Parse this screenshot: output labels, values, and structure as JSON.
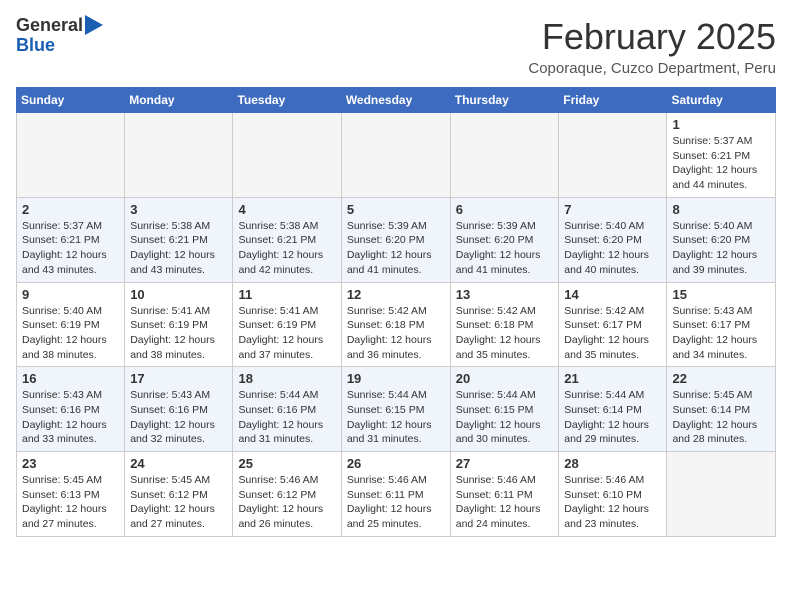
{
  "header": {
    "logo_line1": "General",
    "logo_line2": "Blue",
    "month": "February 2025",
    "location": "Coporaque, Cuzco Department, Peru"
  },
  "days_of_week": [
    "Sunday",
    "Monday",
    "Tuesday",
    "Wednesday",
    "Thursday",
    "Friday",
    "Saturday"
  ],
  "weeks": [
    [
      {
        "day": "",
        "info": ""
      },
      {
        "day": "",
        "info": ""
      },
      {
        "day": "",
        "info": ""
      },
      {
        "day": "",
        "info": ""
      },
      {
        "day": "",
        "info": ""
      },
      {
        "day": "",
        "info": ""
      },
      {
        "day": "1",
        "info": "Sunrise: 5:37 AM\nSunset: 6:21 PM\nDaylight: 12 hours and 44 minutes."
      }
    ],
    [
      {
        "day": "2",
        "info": "Sunrise: 5:37 AM\nSunset: 6:21 PM\nDaylight: 12 hours and 43 minutes."
      },
      {
        "day": "3",
        "info": "Sunrise: 5:38 AM\nSunset: 6:21 PM\nDaylight: 12 hours and 43 minutes."
      },
      {
        "day": "4",
        "info": "Sunrise: 5:38 AM\nSunset: 6:21 PM\nDaylight: 12 hours and 42 minutes."
      },
      {
        "day": "5",
        "info": "Sunrise: 5:39 AM\nSunset: 6:20 PM\nDaylight: 12 hours and 41 minutes."
      },
      {
        "day": "6",
        "info": "Sunrise: 5:39 AM\nSunset: 6:20 PM\nDaylight: 12 hours and 41 minutes."
      },
      {
        "day": "7",
        "info": "Sunrise: 5:40 AM\nSunset: 6:20 PM\nDaylight: 12 hours and 40 minutes."
      },
      {
        "day": "8",
        "info": "Sunrise: 5:40 AM\nSunset: 6:20 PM\nDaylight: 12 hours and 39 minutes."
      }
    ],
    [
      {
        "day": "9",
        "info": "Sunrise: 5:40 AM\nSunset: 6:19 PM\nDaylight: 12 hours and 38 minutes."
      },
      {
        "day": "10",
        "info": "Sunrise: 5:41 AM\nSunset: 6:19 PM\nDaylight: 12 hours and 38 minutes."
      },
      {
        "day": "11",
        "info": "Sunrise: 5:41 AM\nSunset: 6:19 PM\nDaylight: 12 hours and 37 minutes."
      },
      {
        "day": "12",
        "info": "Sunrise: 5:42 AM\nSunset: 6:18 PM\nDaylight: 12 hours and 36 minutes."
      },
      {
        "day": "13",
        "info": "Sunrise: 5:42 AM\nSunset: 6:18 PM\nDaylight: 12 hours and 35 minutes."
      },
      {
        "day": "14",
        "info": "Sunrise: 5:42 AM\nSunset: 6:17 PM\nDaylight: 12 hours and 35 minutes."
      },
      {
        "day": "15",
        "info": "Sunrise: 5:43 AM\nSunset: 6:17 PM\nDaylight: 12 hours and 34 minutes."
      }
    ],
    [
      {
        "day": "16",
        "info": "Sunrise: 5:43 AM\nSunset: 6:16 PM\nDaylight: 12 hours and 33 minutes."
      },
      {
        "day": "17",
        "info": "Sunrise: 5:43 AM\nSunset: 6:16 PM\nDaylight: 12 hours and 32 minutes."
      },
      {
        "day": "18",
        "info": "Sunrise: 5:44 AM\nSunset: 6:16 PM\nDaylight: 12 hours and 31 minutes."
      },
      {
        "day": "19",
        "info": "Sunrise: 5:44 AM\nSunset: 6:15 PM\nDaylight: 12 hours and 31 minutes."
      },
      {
        "day": "20",
        "info": "Sunrise: 5:44 AM\nSunset: 6:15 PM\nDaylight: 12 hours and 30 minutes."
      },
      {
        "day": "21",
        "info": "Sunrise: 5:44 AM\nSunset: 6:14 PM\nDaylight: 12 hours and 29 minutes."
      },
      {
        "day": "22",
        "info": "Sunrise: 5:45 AM\nSunset: 6:14 PM\nDaylight: 12 hours and 28 minutes."
      }
    ],
    [
      {
        "day": "23",
        "info": "Sunrise: 5:45 AM\nSunset: 6:13 PM\nDaylight: 12 hours and 27 minutes."
      },
      {
        "day": "24",
        "info": "Sunrise: 5:45 AM\nSunset: 6:12 PM\nDaylight: 12 hours and 27 minutes."
      },
      {
        "day": "25",
        "info": "Sunrise: 5:46 AM\nSunset: 6:12 PM\nDaylight: 12 hours and 26 minutes."
      },
      {
        "day": "26",
        "info": "Sunrise: 5:46 AM\nSunset: 6:11 PM\nDaylight: 12 hours and 25 minutes."
      },
      {
        "day": "27",
        "info": "Sunrise: 5:46 AM\nSunset: 6:11 PM\nDaylight: 12 hours and 24 minutes."
      },
      {
        "day": "28",
        "info": "Sunrise: 5:46 AM\nSunset: 6:10 PM\nDaylight: 12 hours and 23 minutes."
      },
      {
        "day": "",
        "info": ""
      }
    ]
  ]
}
